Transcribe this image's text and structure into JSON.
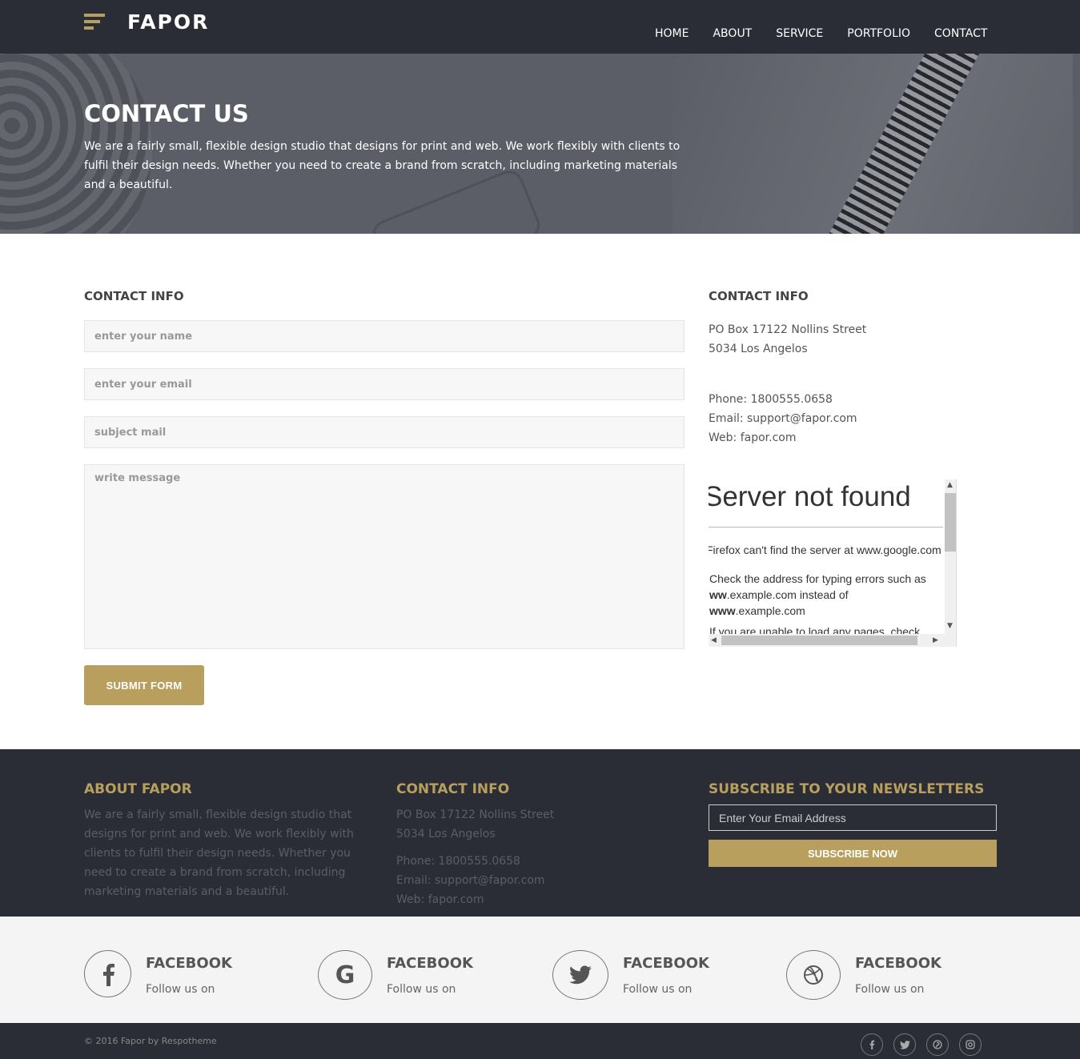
{
  "header": {
    "logo_text": "FAPOR",
    "nav": [
      "HOME",
      "ABOUT",
      "SERVICE",
      "PORTFOLIO",
      "CONTACT"
    ]
  },
  "hero": {
    "title": "CONTACT US",
    "text": "We are a fairly small, flexible design studio that designs for print and web. We work flexibly with clients to fulfil their design needs. Whether you need to create a brand from scratch, including marketing materials and a beautiful."
  },
  "form": {
    "title": "CONTACT INFO",
    "name_placeholder": "enter your name",
    "email_placeholder": "enter your email",
    "subject_placeholder": "subject mail",
    "message_placeholder": "write message",
    "submit_label": "SUBMIT FORM"
  },
  "contact_info": {
    "title": "CONTACT INFO",
    "address_line1": "PO Box 17122 Nollins Street",
    "address_line2": "5034 Los Angelos",
    "phone": "Phone: 1800555.0658",
    "email": "Email: support@fapor.com",
    "web": "Web: fapor.com"
  },
  "map_error": {
    "title": "Server not found",
    "message": "Firefox can't find the server at www.google.com",
    "tip_prefix": "Check the address for typing errors such as ",
    "tip_bold1": "ww",
    "tip_mid": ".example.com instead of ",
    "tip_bold2": "www",
    "tip_end": ".example.com",
    "tip2": "If you are unable to load any pages, check"
  },
  "footer": {
    "about_title": "ABOUT FAPOR",
    "about_text": "We are a fairly small, flexible design studio that designs for print and web. We work flexibly with clients to fulfil their design needs. Whether you need to create a brand from scratch, including marketing materials and a beautiful.",
    "contact_title": "CONTACT INFO",
    "address_line1": "PO Box 17122 Nollins Street",
    "address_line2": "5034 Los Angelos",
    "phone": "Phone: 1800555.0658",
    "email": "Email: support@fapor.com",
    "web": "Web: fapor.com",
    "newsletter_title": "SUBSCRIBE TO YOUR NEWSLETTERS",
    "newsletter_placeholder": "Enter Your Email Address",
    "newsletter_button": "SUBSCRIBE NOW"
  },
  "social": [
    {
      "icon": "facebook-icon",
      "name": "FACEBOOK",
      "sub": "Follow us on"
    },
    {
      "icon": "google-icon",
      "name": "FACEBOOK",
      "sub": "Follow us on"
    },
    {
      "icon": "twitter-icon",
      "name": "FACEBOOK",
      "sub": "Follow us on"
    },
    {
      "icon": "dribbble-icon",
      "name": "FACEBOOK",
      "sub": "Follow us on"
    }
  ],
  "bottom": {
    "copyright": "© 2016 Fapor by Respotheme",
    "icons": [
      "facebook-icon",
      "twitter-icon",
      "pinterest-icon",
      "instagram-icon"
    ]
  },
  "colors": {
    "accent": "#b89f5d",
    "dark": "#2a2d35"
  }
}
